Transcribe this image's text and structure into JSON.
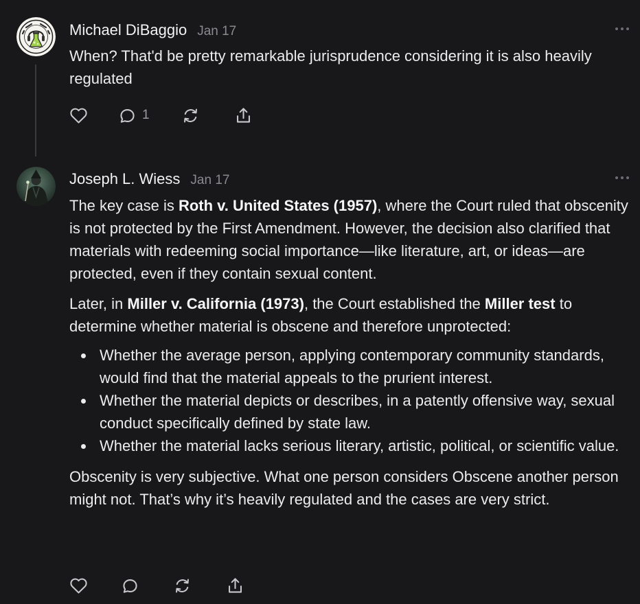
{
  "comments": [
    {
      "author": "Michael DiBaggio",
      "date": "Jan 17",
      "text": "When? That'd be pretty remarkable jurisprudence considering it is also heavily regulated",
      "reply_count": "1"
    },
    {
      "author": "Joseph L. Wiess",
      "date": "Jan 17",
      "p1": {
        "a": "The key case is ",
        "b": "Roth v. United States (1957)",
        "c": ", where the Court ruled that obscenity is not protected by the First Amendment. However, the decision also clarified that materials with redeeming social importance—like literature, art, or ideas—are protected, even if they contain sexual content."
      },
      "p2": {
        "a": "Later, in ",
        "b": "Miller v. California (1973)",
        "c": ", the Court established the ",
        "d": "Miller test",
        "e": " to determine whether material is obscene and therefore unprotected:"
      },
      "bullets": [
        "Whether the average person, applying contemporary community standards, would find that the material appeals to the prurient interest.",
        "Whether the material depicts or describes, in a patently offensive way, sexual conduct specifically defined by state law.",
        "Whether the material lacks serious literary, artistic, political, or scientific value."
      ],
      "p3": "Obscenity is very subjective. What one person considers Obscene another person might not. That’s why it’s heavily regulated and the cases are very strict."
    }
  ],
  "icons": {
    "like": "heart-icon",
    "reply": "comment-icon",
    "restack": "restack-icon",
    "share": "share-icon",
    "more": "more-options-icon"
  },
  "colors": {
    "background": "#18181a",
    "text": "#ececee",
    "muted": "#8a8a8f",
    "icon": "#c9c9cd",
    "thread_line": "#3a3a3d"
  }
}
